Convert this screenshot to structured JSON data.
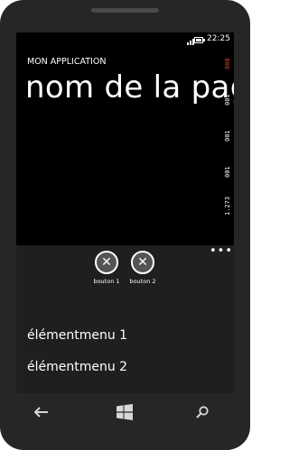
{
  "status": {
    "time": "22:25",
    "signal_icon": "signal-icon",
    "battery_icon": "battery-icon"
  },
  "header": {
    "app_title": "MON APPLICATION",
    "page_title": "nom de la page"
  },
  "counters": [
    "000",
    "001",
    "001",
    "001",
    "1.273"
  ],
  "appbar": {
    "ellipsis": "•••",
    "buttons": [
      {
        "label": "bouton 1",
        "icon": "cancel-icon"
      },
      {
        "label": "bouton 2",
        "icon": "cancel-icon"
      }
    ],
    "menu_items": [
      "élémentmenu 1",
      "élémentmenu 2"
    ]
  },
  "nav": {
    "back_icon": "back-arrow-icon",
    "start_icon": "windows-logo-icon",
    "search_icon": "search-icon"
  },
  "colors": {
    "counter_highlight": "#e04020"
  }
}
